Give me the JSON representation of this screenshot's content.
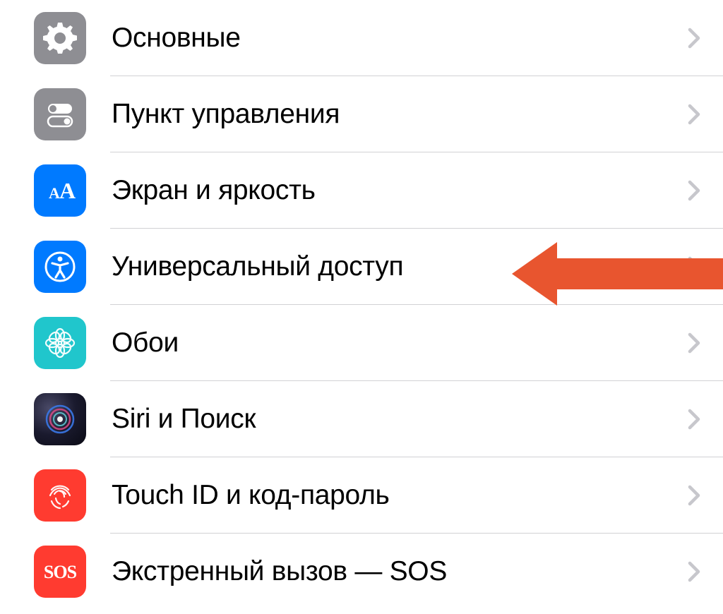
{
  "colors": {
    "accent": "#007aff",
    "arrow": "#e8552f",
    "separator": "#d1d1d4",
    "chevron": "#c7c7cc",
    "gray": "#8e8e93",
    "teal": "#20c6cc",
    "red": "#ff3b30"
  },
  "items": [
    {
      "id": "general",
      "label": "Основные",
      "icon": "gear-icon",
      "bg": "icon-bg-gray"
    },
    {
      "id": "control-center",
      "label": "Пункт управления",
      "icon": "toggles-icon",
      "bg": "icon-bg-gray"
    },
    {
      "id": "display",
      "label": "Экран и яркость",
      "icon": "text-size-icon",
      "bg": "icon-bg-blue"
    },
    {
      "id": "accessibility",
      "label": "Универсальный доступ",
      "icon": "accessibility-icon",
      "bg": "icon-bg-blue"
    },
    {
      "id": "wallpaper",
      "label": "Обои",
      "icon": "wallpaper-icon",
      "bg": "icon-bg-teal"
    },
    {
      "id": "siri",
      "label": "Siri и Поиск",
      "icon": "siri-icon",
      "bg": "icon-bg-siri"
    },
    {
      "id": "touch-id",
      "label": "Touch ID и код-пароль",
      "icon": "fingerprint-icon",
      "bg": "icon-bg-red"
    },
    {
      "id": "emergency-sos",
      "label": "Экстренный вызов — SOS",
      "icon": "sos-icon",
      "bg": "icon-bg-red"
    }
  ],
  "annotation": {
    "target": "accessibility"
  }
}
